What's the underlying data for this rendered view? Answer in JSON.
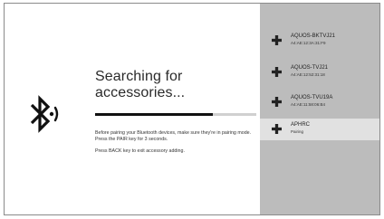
{
  "colors": {
    "device_list_background": "#bcbcbc",
    "selected_item_background": "#e1e1e1",
    "progress_bar": "#111111"
  },
  "search": {
    "icon": "bluetooth-searching-icon",
    "title": "Searching for accessories...",
    "progress_fraction": 0.73,
    "instructions": [
      "Before pairing your Bluetooth devices, make sure they're in pairing mode. Press the PAIR key for 3 seconds.",
      "Press BACK key to exit accessory adding."
    ]
  },
  "devices": [
    {
      "icon": "bluetooth-device-icon",
      "name": "AQUOS-BKTVJ21",
      "detail": "A4:AE:12:3A:31:F9",
      "selected": false
    },
    {
      "icon": "bluetooth-device-icon",
      "name": "AQUOS-TVJ21",
      "detail": "A4:AE:12:52:31:18",
      "selected": false
    },
    {
      "icon": "bluetooth-device-icon",
      "name": "AQUOS-TVU19A",
      "detail": "A4:AE:11:58:06:B4",
      "selected": false
    },
    {
      "icon": "bluetooth-device-icon",
      "name": "APHRC",
      "detail": "Pairing",
      "selected": true
    }
  ]
}
